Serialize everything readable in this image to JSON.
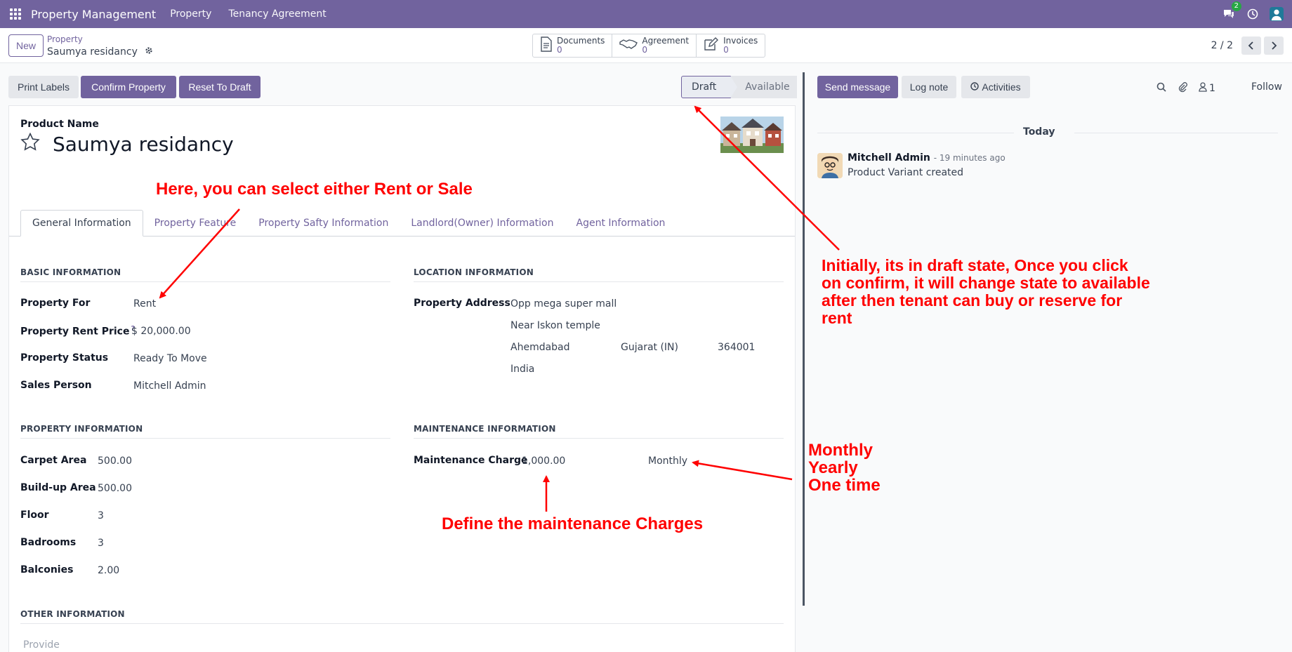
{
  "navbar": {
    "app_name": "Property Management",
    "menus": [
      "Property",
      "Tenancy Agreement"
    ],
    "messages_badge": "2"
  },
  "control_panel": {
    "new_label": "New",
    "breadcrumb": "Property",
    "record_name": "Saumya residancy",
    "smart_buttons": [
      {
        "label": "Documents",
        "count": "0"
      },
      {
        "label": "Agreement",
        "count": "0"
      },
      {
        "label": "Invoices",
        "count": "0"
      }
    ],
    "pager": "2 / 2"
  },
  "actions": {
    "print_labels": "Print Labels",
    "confirm_property": "Confirm Property",
    "reset_to_draft": "Reset To Draft"
  },
  "statusbar": {
    "stages": [
      "Draft",
      "Available"
    ],
    "active": "Draft"
  },
  "form": {
    "product_name_label": "Product Name",
    "product_name": "Saumya residancy",
    "tabs": [
      "General Information",
      "Property Feature",
      "Property Safty Information",
      "Landlord(Owner) Information",
      "Agent Information"
    ],
    "basic_info": {
      "title": "BASIC INFORMATION",
      "property_for_label": "Property For",
      "property_for": "Rent",
      "rent_price_label": "Property Rent Price",
      "help_marker": "?",
      "rent_price": "$ 20,000.00",
      "status_label": "Property Status",
      "status": "Ready To Move",
      "sales_person_label": "Sales Person",
      "sales_person": "Mitchell Admin"
    },
    "location_info": {
      "title": "LOCATION INFORMATION",
      "address_label": "Property Address",
      "street": "Opp mega super mall",
      "street2": "Near Iskon temple",
      "city": "Ahemdabad",
      "state": "Gujarat (IN)",
      "zip": "364001",
      "country": "India"
    },
    "property_info": {
      "title": "PROPERTY INFORMATION",
      "carpet_area_label": "Carpet Area",
      "carpet_area": "500.00",
      "buildup_area_label": "Build-up Area",
      "buildup_area": "500.00",
      "floor_label": "Floor",
      "floor": "3",
      "bedrooms_label": "Badrooms",
      "bedrooms": "3",
      "balconies_label": "Balconies",
      "balconies": "2.00"
    },
    "maintenance_info": {
      "title": "MAINTENANCE INFORMATION",
      "charge_label": "Maintenance Charge",
      "charge": "1,000.00",
      "period": "Monthly"
    },
    "other_info": {
      "title": "OTHER INFORMATION",
      "provide_placeholder": "Provide"
    }
  },
  "chatter": {
    "send_message": "Send message",
    "log_note": "Log note",
    "activities": "Activities",
    "followers_count": "1",
    "follow": "Follow",
    "date_separator": "Today",
    "message": {
      "author": "Mitchell Admin",
      "time": "- 19 minutes ago",
      "body": "Product Variant created"
    }
  },
  "annotations": {
    "rent_or_sale": "Here, you can select either Rent or Sale",
    "draft_state": [
      "Initially, its in draft state, Once you click",
      "on confirm, it will change state to available",
      "after then tenant can buy or reserve for",
      "rent"
    ],
    "periods": [
      "Monthly",
      "Yearly",
      "One time"
    ],
    "maintenance": "Define the maintenance Charges"
  },
  "colors": {
    "brand": "#71639e",
    "annotation": "#ff0000",
    "badge": "#28a745"
  }
}
